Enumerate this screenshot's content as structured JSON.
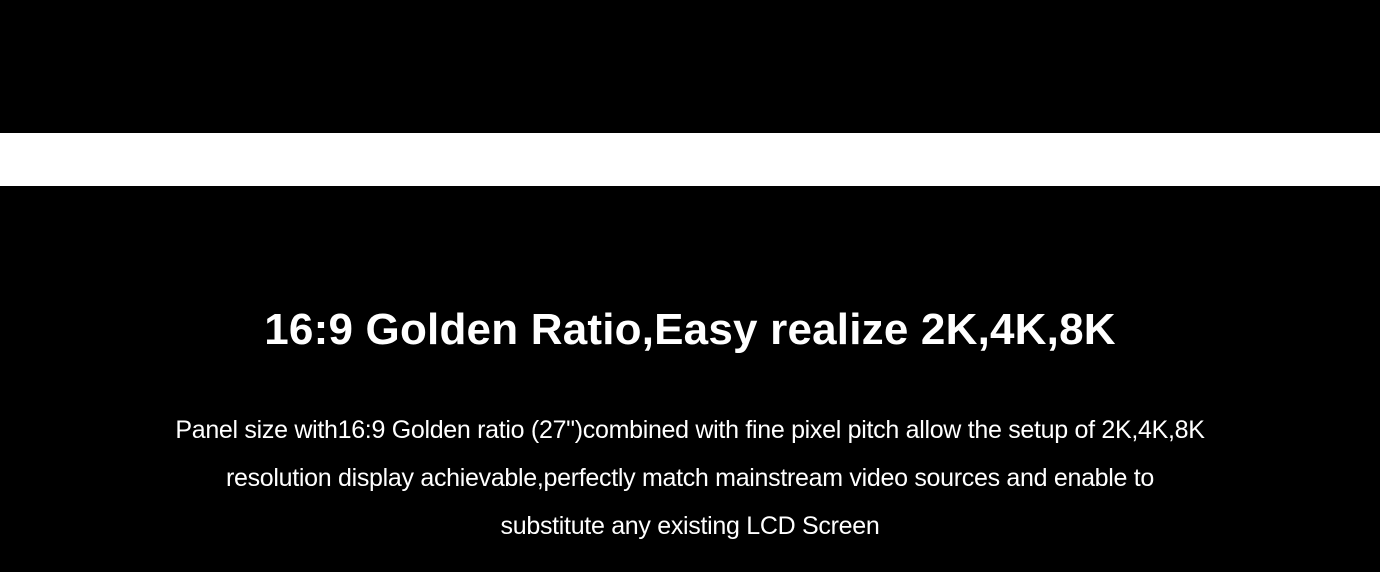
{
  "colors": {
    "background": "#000000",
    "band": "#ffffff",
    "text": "#ffffff"
  },
  "section": {
    "headline": "16:9 Golden Ratio,Easy realize 2K,4K,8K",
    "description_lines": [
      "Panel size with16:9 Golden ratio (27\")combined with fine pixel pitch allow the setup of 2K,4K,8K",
      "resolution display achievable,perfectly match mainstream video sources and enable to",
      "substitute any existing LCD Screen"
    ]
  }
}
